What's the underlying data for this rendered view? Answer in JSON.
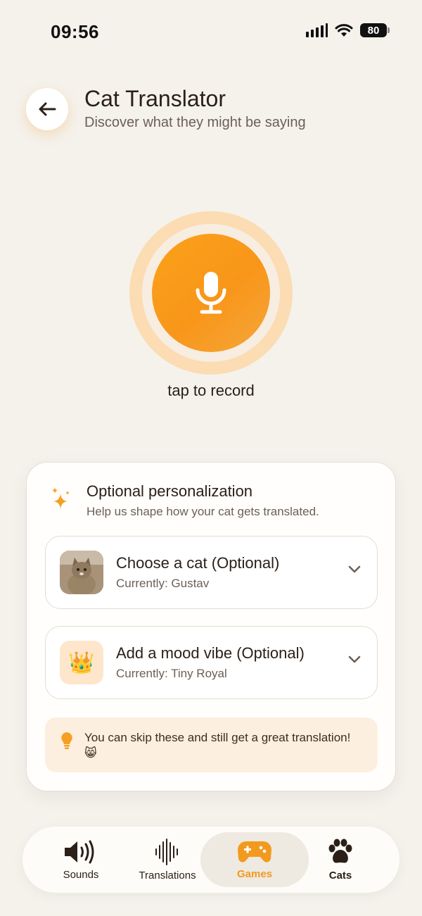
{
  "status_bar": {
    "time": "09:56",
    "battery": "80"
  },
  "header": {
    "back_icon": "arrow-left-icon",
    "title": "Cat Translator",
    "subtitle": "Discover what they might be saying"
  },
  "recorder": {
    "icon": "microphone-icon",
    "label": "tap to record"
  },
  "personalization": {
    "icon": "sparkle-icon",
    "title": "Optional personalization",
    "description": "Help us shape how your cat gets translated.",
    "cat_select": {
      "title": "Choose a cat (Optional)",
      "current": "Currently: Gustav"
    },
    "mood_select": {
      "emoji": "👑",
      "title": "Add a mood vibe (Optional)",
      "current": "Currently: Tiny Royal"
    },
    "tip": {
      "icon": "lightbulb-icon",
      "text": "You can skip these and still get a great translation! 😸"
    }
  },
  "bottom_nav": {
    "items": [
      {
        "label": "Sounds",
        "icon": "speaker-icon"
      },
      {
        "label": "Translations",
        "icon": "waveform-icon"
      },
      {
        "label": "Games",
        "icon": "gamepad-icon",
        "active": true
      },
      {
        "label": "Cats",
        "icon": "paw-icon"
      }
    ],
    "active_color": "#f29a1e"
  },
  "colors": {
    "background": "#f5f2ec",
    "accent": "#f8961a",
    "accent_light": "#fbdcb3"
  }
}
